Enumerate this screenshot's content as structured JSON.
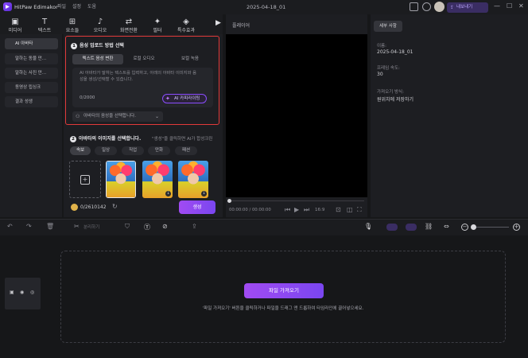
{
  "app": {
    "name": "HitPaw Edimakor",
    "menus": [
      "파일",
      "설정",
      "도움"
    ],
    "project_title": "2025-04-18_01",
    "export_label": "내보내기"
  },
  "toolbar": {
    "tools": [
      {
        "label": "미디어",
        "icon": "media-icon"
      },
      {
        "label": "텍스트",
        "icon": "text-icon"
      },
      {
        "label": "요소들",
        "icon": "elements-icon"
      },
      {
        "label": "오디오",
        "icon": "audio-icon"
      },
      {
        "label": "화면전환",
        "icon": "transition-icon"
      },
      {
        "label": "필터",
        "icon": "filter-icon"
      },
      {
        "label": "특수효과",
        "icon": "effects-icon"
      }
    ]
  },
  "sidebar": {
    "items": [
      {
        "label": "AI 아바타",
        "active": true
      },
      {
        "label": "말하는 동물 만...",
        "active": false
      },
      {
        "label": "말하는 사진 만...",
        "active": false
      },
      {
        "label": "동영상 립싱크",
        "active": false
      },
      {
        "label": "결과 성생",
        "active": false
      }
    ]
  },
  "section1": {
    "number": "1",
    "title": "음성 업로드 방법 선택",
    "tabs": [
      "텍스트 음성 변환",
      "로컬 오디오",
      "보컬 녹음"
    ],
    "placeholder": "AI 아바타가 말하는 텍스트를 입력하고, 아래의 아바타 이미지와 음성을 생성/선택할 수 있습니다.",
    "counter": "0/2000",
    "ai_copy_label": "AI 카피라이팅",
    "voice_select_label": "아바타의 음성을 선택합니다."
  },
  "section2": {
    "number": "2",
    "title": "아바타의 이미지를 선택합니다.",
    "hint": "\"생성\"을 클릭하면 AI가 합성크린",
    "chips": [
      "속보",
      "일상",
      "직업",
      "만화",
      "패션"
    ]
  },
  "credits": {
    "value": "0/2610142"
  },
  "generate_label": "생성",
  "player": {
    "title": "플레이어",
    "time": "00:00:00 / 00:00:00",
    "ratio": "16:9"
  },
  "details": {
    "tab_label": "세부 사항",
    "name_label": "이름:",
    "name_value": "2025-04-18_01",
    "fps_label": "프레임 속도:",
    "fps_value": "30",
    "import_label": "가져오기 방식:",
    "import_value": "원위치에 저장하기"
  },
  "timeline": {
    "split_label": "분리하기",
    "import_button": "파일 가져오기",
    "drop_hint": "'파일 가져오기' 버튼을 클릭하거나 파일을 드래그 앤 드롭하여 타임라인에 끌어넣으세요."
  },
  "colors": {
    "accent": "#8b4dff",
    "highlight_border": "#e23a3a",
    "background": "#161719"
  }
}
